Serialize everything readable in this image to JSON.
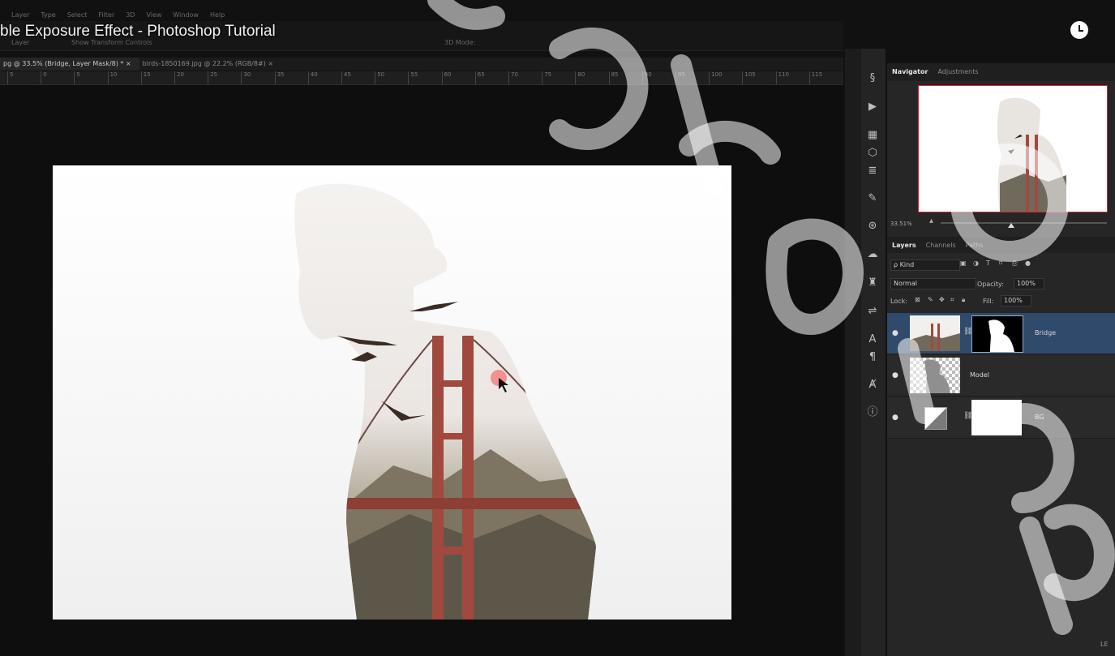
{
  "video": {
    "title": "ble Exposure Effect - Photoshop Tutorial"
  },
  "menubar": [
    "Layer",
    "Type",
    "Select",
    "Filter",
    "3D",
    "View",
    "Window",
    "Help"
  ],
  "options": {
    "auto_select_value": "Layer",
    "transform_label": "Show Transform Controls",
    "mode_3d": "3D Mode:"
  },
  "doc_tabs": [
    {
      "label": "pg @ 33.5% (Bridge, Layer Mask/8) *",
      "close": "×",
      "active": true
    },
    {
      "label": "birds-1850169.jpg @ 22.2% (RGB/8#)",
      "close": "×",
      "active": false
    }
  ],
  "ruler_ticks": [
    "5",
    "0",
    "5",
    "10",
    "15",
    "20",
    "25",
    "30",
    "35",
    "40",
    "45",
    "50",
    "55",
    "60",
    "65",
    "70",
    "75",
    "80",
    "85",
    "90",
    "95",
    "100",
    "105",
    "110",
    "115"
  ],
  "navigator": {
    "tabs": [
      "Navigator",
      "Adjustments"
    ],
    "zoom": "33.51%"
  },
  "layers_panel": {
    "tabs": [
      "Layers",
      "Channels",
      "Paths"
    ],
    "kind_label": "ρ Kind",
    "blend_mode": "Normal",
    "opacity_label": "Opacity:",
    "opacity_value": "100%",
    "lock_label": "Lock:",
    "fill_label": "Fill:",
    "fill_value": "100%",
    "layers": [
      {
        "name": "Bridge",
        "selected": true
      },
      {
        "name": "Model",
        "selected": false
      },
      {
        "name": "BG",
        "selected": false
      }
    ]
  },
  "icons": [
    "history-icon",
    "play-icon",
    "histogram-icon",
    "3d-cube-icon",
    "properties-icon",
    "brush-icon",
    "clone-source-icon",
    "creative-cloud-icon",
    "puppet-icon",
    "adjustment-icon",
    "character-icon",
    "paragraph-icon",
    "glyphs-icon",
    "info-icon"
  ],
  "corner_text": "LE",
  "colors": {
    "selection": "#2f4a6b",
    "navigator_border": "#d23333",
    "cursor_dot": "#f27a7a"
  }
}
